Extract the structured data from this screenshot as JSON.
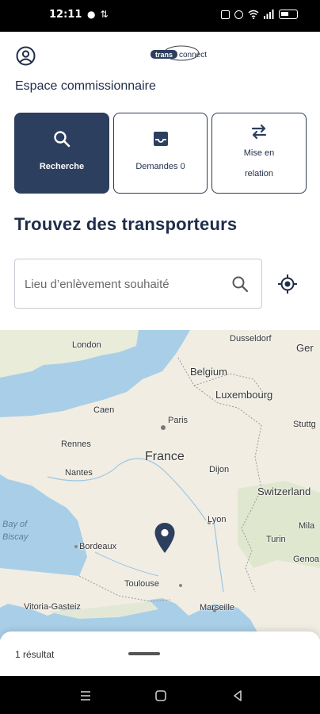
{
  "status_bar": {
    "time": "12:11",
    "left_icons": [
      "app-notification-icon",
      "sync-icon"
    ],
    "right_icons": [
      "nfc-icon",
      "alarm-icon",
      "wifi-icon",
      "signal-icon",
      "battery-icon"
    ]
  },
  "header": {
    "logo_text": "transconnect",
    "section_label": "Espace commissionnaire"
  },
  "tabs": [
    {
      "label": "Recherche",
      "icon": "search-icon",
      "active": true
    },
    {
      "label": "Demandes 0",
      "icon": "inbox-icon",
      "active": false
    },
    {
      "label": "Mise en relation",
      "icon": "swap-arrows-icon",
      "active": false
    }
  ],
  "main": {
    "headline": "Trouvez des transporteurs",
    "search": {
      "placeholder": "Lieu d’enlèvement souhaité",
      "value": ""
    }
  },
  "map": {
    "labels": {
      "london": "London",
      "dusseldorf": "Dusseldorf",
      "germany": "Ger",
      "belgium": "Belgium",
      "luxembourg": "Luxembourg",
      "caen": "Caen",
      "paris": "Paris",
      "stuttgart": "Stuttg",
      "rennes": "Rennes",
      "france": "France",
      "nantes": "Nantes",
      "dijon": "Dijon",
      "switzerland": "Switzerland",
      "bay1": "Bay of",
      "bay2": "Biscay",
      "lyon": "Lyon",
      "milan": "Mila",
      "bordeaux": "Bordeaux",
      "turin": "Turin",
      "genoa": "Genoa",
      "toulouse": "Toulouse",
      "marseille": "Marseille",
      "vitoria": "Vitoria-Gasteiz"
    },
    "colors": {
      "sea": "#a9cfe8",
      "land": "#f1ede3",
      "pin": "#2d3f5e"
    }
  },
  "bottom_sheet": {
    "results": "1 résultat"
  },
  "colors": {
    "primary": "#2d3f5e",
    "text": "#1f2d4a",
    "border": "#c7cbd3"
  }
}
